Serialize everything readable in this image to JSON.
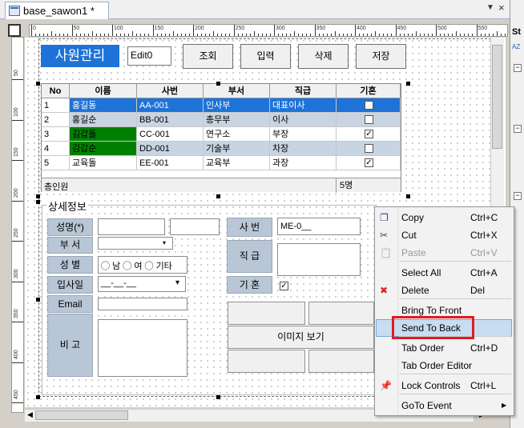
{
  "tab": {
    "title": "base_sawon1 *",
    "close_glyph": "×",
    "arrow_glyph": "▼"
  },
  "right_panel": {
    "label": "St",
    "sort_label": "AZ"
  },
  "form": {
    "title": "사원관리",
    "edit_value": "Edit0",
    "buttons": [
      "조회",
      "입력",
      "삭제",
      "저장"
    ]
  },
  "grid": {
    "columns": [
      "No",
      "이름",
      "사번",
      "부서",
      "직급",
      "기혼"
    ],
    "rows": [
      {
        "no": "1",
        "name": "홍길동",
        "id": "AA-001",
        "dept": "인사부",
        "rank": "대표이사",
        "married": true
      },
      {
        "no": "2",
        "name": "홍길순",
        "id": "BB-001",
        "dept": "총무부",
        "rank": "이사",
        "married": false
      },
      {
        "no": "3",
        "name": "김갑돌",
        "id": "CC-001",
        "dept": "연구소",
        "rank": "부장",
        "married": true
      },
      {
        "no": "4",
        "name": "김갑순",
        "id": "DD-001",
        "dept": "기술부",
        "rank": "차장",
        "married": false
      },
      {
        "no": "5",
        "name": "교육돌",
        "id": "EE-001",
        "dept": "교육부",
        "rank": "과장",
        "married": true
      }
    ],
    "footer_label": "총인원",
    "footer_count": "5명"
  },
  "detail": {
    "title": "상세정보",
    "labels": {
      "name": "성명(*)",
      "dept": "부 서",
      "gender": "성 별",
      "join": "입사일",
      "email": "Email",
      "memo": "비 고",
      "id": "사 번",
      "rank": "직 급",
      "married": "기 혼"
    },
    "gender_options": [
      "남",
      "여",
      "기타"
    ],
    "join_mask": "__-__-__",
    "id_value": "ME-0__",
    "image_button": "이미지 보기"
  },
  "ruler": {
    "h": [
      "0",
      "50",
      "100",
      "150",
      "200",
      "250",
      "300",
      "350",
      "400",
      "450",
      "500",
      "550",
      "600"
    ],
    "v": [
      "50",
      "100",
      "150",
      "200",
      "250",
      "300",
      "350",
      "400",
      "450"
    ]
  },
  "menu": {
    "items": [
      {
        "label": "Copy",
        "shortcut": "Ctrl+C",
        "icon": "copy-icon"
      },
      {
        "label": "Cut",
        "shortcut": "Ctrl+X",
        "icon": "scissors-icon"
      },
      {
        "label": "Paste",
        "shortcut": "Ctrl+V",
        "icon": "paste-icon",
        "disabled": true
      },
      {
        "label": "Select All",
        "shortcut": "Ctrl+A"
      },
      {
        "label": "Delete",
        "shortcut": "Del",
        "icon": "delete-icon"
      },
      {
        "label": "Bring To Front"
      },
      {
        "label": "Send To Back",
        "highlighted": true
      },
      {
        "label": "Tab Order",
        "shortcut": "Ctrl+D"
      },
      {
        "label": "Tab Order Editor"
      },
      {
        "label": "Lock Controls",
        "shortcut": "Ctrl+L",
        "icon": "pin-icon"
      },
      {
        "label": "GoTo Event",
        "submenu_glyph": "▶"
      }
    ]
  },
  "colors": {
    "accent": "#1e73d8",
    "selected_row": "#1e73d8",
    "alt_row": "#c8d4e2",
    "green_cell": "#008000",
    "highlight": "#c7ddf1",
    "red_box": "#e01b22"
  }
}
